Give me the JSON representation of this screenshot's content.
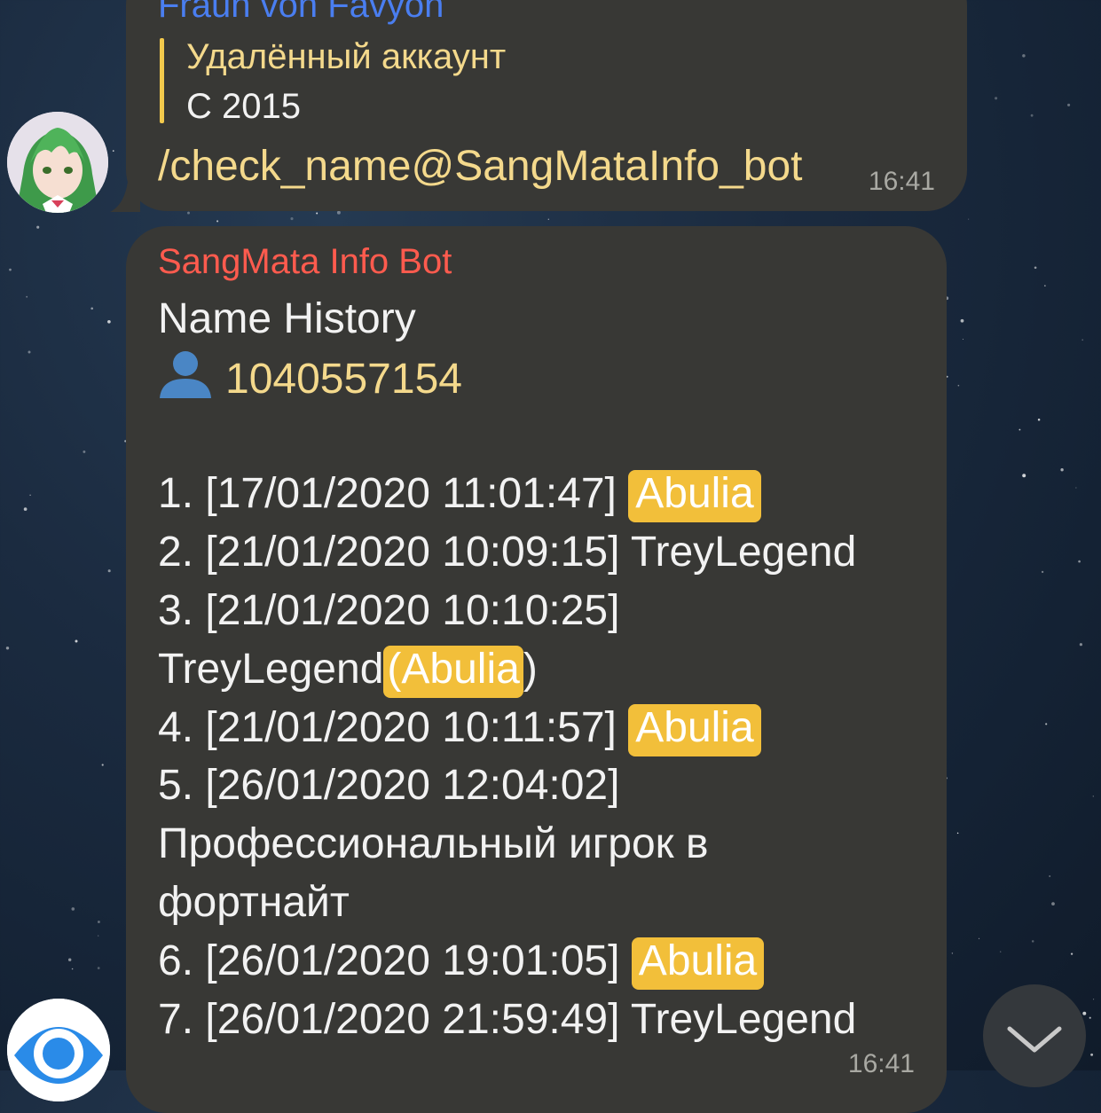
{
  "messages": [
    {
      "sender": "Fraun von Favyon",
      "reply": {
        "title": "Удалённый аккаунт",
        "text": "С 2015"
      },
      "text": "/check_name@SangMataInfo_bot",
      "time": "16:41",
      "avatar_icon": "anime-character-avatar"
    },
    {
      "sender": "SangMata Info Bot",
      "heading": "Name History",
      "user_icon": "bust-silhouette-icon",
      "user_id": "1040557154",
      "entries": [
        {
          "prefix": "1. [17/01/2020 11:01:47] ",
          "name": "Abulia",
          "highlight": true
        },
        {
          "prefix": "2. [21/01/2020 10:09:15] ",
          "name": "TreyLegend",
          "highlight": false
        },
        {
          "prefix": "3. [21/01/2020 10:10:25]",
          "name": "TreyLegend",
          "paren_open": "(",
          "paren_name": "Abulia",
          "paren_close": ")"
        },
        {
          "prefix": "4. [21/01/2020 10:11:57] ",
          "name": "Abulia",
          "highlight": true
        },
        {
          "prefix": "5. [26/01/2020 12:04:02]",
          "name_line1": "Профессиональный игрок в",
          "name_line2": "фортнайт"
        },
        {
          "prefix": "6. [26/01/2020 19:01:05] ",
          "name": "Abulia",
          "highlight": true
        },
        {
          "prefix": "7. [26/01/2020 21:59:49] ",
          "name": "TreyLegend",
          "highlight": false
        }
      ],
      "time": "16:41",
      "avatar_icon": "eye-icon"
    }
  ],
  "scroll_button_icon": "chevron-down-icon",
  "colors": {
    "bubble": "#383835",
    "sender_blue": "#4a7ef0",
    "sender_red": "#ff5b4e",
    "reply_yellow": "#f4d98c",
    "highlight": "#f2bf3a"
  }
}
